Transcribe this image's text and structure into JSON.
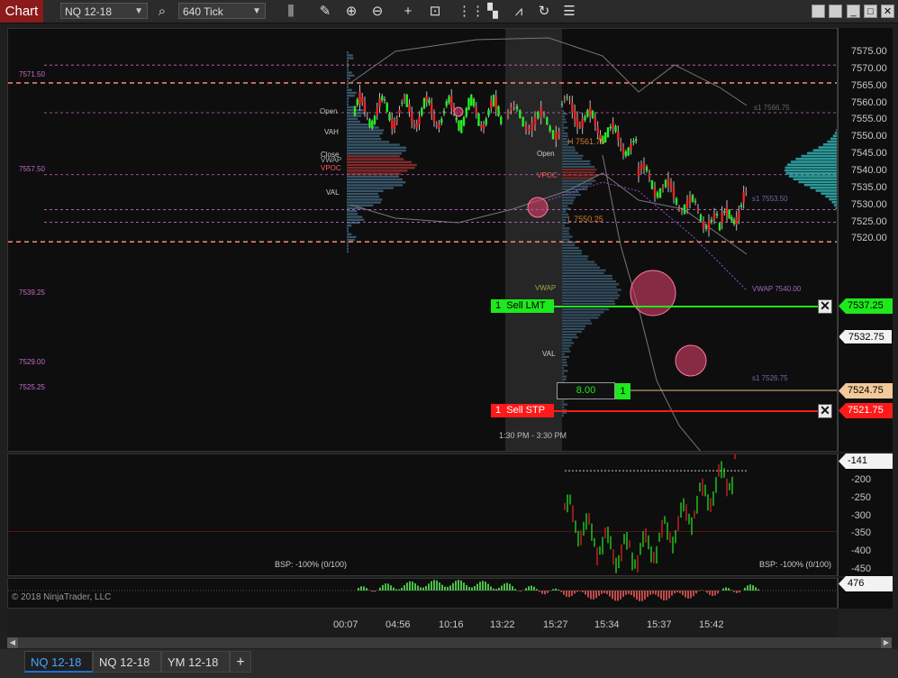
{
  "toolbar": {
    "title": "Chart",
    "instrument": "NQ 12-18",
    "interval": "640 Tick"
  },
  "price_axis": {
    "ticks": [
      "7575.00",
      "7570.00",
      "7565.00",
      "7560.00",
      "7555.00",
      "7550.00",
      "7545.00",
      "7540.00",
      "7535.00",
      "7530.00",
      "7525.00",
      "7520.00"
    ],
    "flag_top": "7537.25",
    "flag_last": "7532.75",
    "flag_mid": "7524.75",
    "flag_bottom": "7521.75"
  },
  "levels": [
    "7571.50",
    "7557.50",
    "7539.25",
    "7529.00",
    "7525.25"
  ],
  "profile_labels": {
    "open": "Open",
    "vah": "VAH",
    "close": "Close",
    "vwap": "VWAP",
    "vpoc": "VPOC",
    "val": "VAL",
    "open2": "Open",
    "vpoc2": "VPOC",
    "vwap2": "VWAP",
    "val2": "VAL",
    "h_label": "H 7561.75",
    "l_label": "L 7550.25",
    "s1_a": "s1 7566.75",
    "s1_b": "s1 7553.50",
    "vwap_label": "VWAP 7540.00",
    "s1_c": "s1 7526.75"
  },
  "orders": {
    "sell_lmt_qty": "1",
    "sell_lmt_label": "Sell LMT",
    "sell_stp_qty": "1",
    "sell_stp_label": "Sell STP",
    "position_pnl": "8.00",
    "position_qty": "1"
  },
  "session_label": "1:30 PM - 3:30 PM",
  "indicator1": {
    "ticks": [
      "-200",
      "-250",
      "-300",
      "-350",
      "-400",
      "-450"
    ],
    "flag": "-141",
    "bsp_left": "BSP: -100% (0/100)",
    "bsp_right": "BSP: -100% (0/100)"
  },
  "indicator2": {
    "flag": "476",
    "copyright": "© 2018 NinjaTrader, LLC"
  },
  "time_axis": [
    "00:07",
    "04:56",
    "10:16",
    "13:22",
    "15:27",
    "15:34",
    "15:37",
    "15:42"
  ],
  "tabs": [
    "NQ 12-18",
    "NQ 12-18",
    "YM 12-18"
  ],
  "colors": {
    "bullish": "#22ee22",
    "bearish": "#ee2222",
    "flag_green": "#1ee81e",
    "flag_red": "#ff1a1a",
    "flag_tan": "#f1c99a",
    "level_pink": "#c46cc4",
    "dashed_orange": "#ff8a6a"
  }
}
